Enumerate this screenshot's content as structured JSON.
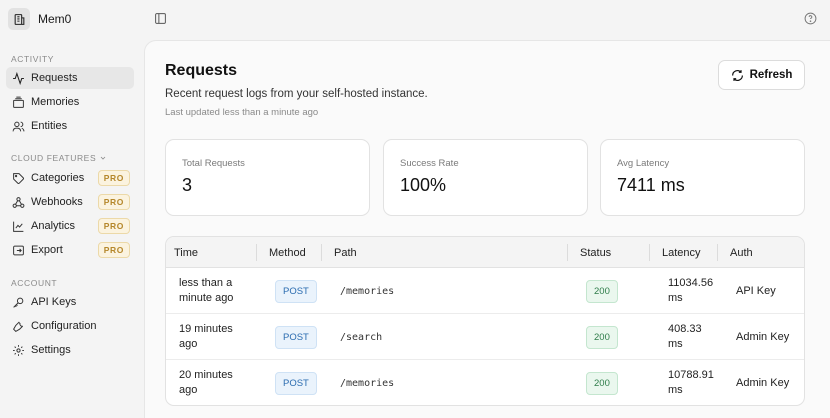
{
  "app": {
    "name": "Mem0"
  },
  "sidebar": {
    "activity_label": "ACTIVITY",
    "activity_items": [
      {
        "label": "Requests",
        "icon": "activity-icon",
        "active": true
      },
      {
        "label": "Memories",
        "icon": "memories-icon"
      },
      {
        "label": "Entities",
        "icon": "users-icon"
      }
    ],
    "cloud_label": "CLOUD FEATURES",
    "cloud_items": [
      {
        "label": "Categories",
        "icon": "tag-icon",
        "badge": "PRO"
      },
      {
        "label": "Webhooks",
        "icon": "webhook-icon",
        "badge": "PRO"
      },
      {
        "label": "Analytics",
        "icon": "chart-icon",
        "badge": "PRO"
      },
      {
        "label": "Export",
        "icon": "export-icon",
        "badge": "PRO"
      }
    ],
    "account_label": "ACCOUNT",
    "account_items": [
      {
        "label": "API Keys",
        "icon": "key-icon"
      },
      {
        "label": "Configuration",
        "icon": "wrench-icon"
      },
      {
        "label": "Settings",
        "icon": "gear-icon"
      }
    ]
  },
  "header": {
    "title": "Requests",
    "subtitle": "Recent request logs from your self-hosted instance.",
    "updated": "Last updated less than a minute ago",
    "refresh_label": "Refresh"
  },
  "stats": [
    {
      "label": "Total Requests",
      "value": "3"
    },
    {
      "label": "Success Rate",
      "value": "100%"
    },
    {
      "label": "Avg Latency",
      "value": "7411 ms"
    }
  ],
  "table": {
    "columns": [
      "Time",
      "Method",
      "Path",
      "Status",
      "Latency",
      "Auth"
    ],
    "rows": [
      {
        "time": "less than a minute ago",
        "method": "POST",
        "path": "/memories",
        "status": "200",
        "latency": "11034.56 ms",
        "auth": "API Key"
      },
      {
        "time": "19 minutes ago",
        "method": "POST",
        "path": "/search",
        "status": "200",
        "latency": "408.33 ms",
        "auth": "Admin Key"
      },
      {
        "time": "20 minutes ago",
        "method": "POST",
        "path": "/memories",
        "status": "200",
        "latency": "10788.91 ms",
        "auth": "Admin Key"
      }
    ]
  },
  "colors": {
    "pro_badge": "#b5872b",
    "method_badge": "#2b6cb0",
    "status_badge": "#2f7d4a"
  }
}
